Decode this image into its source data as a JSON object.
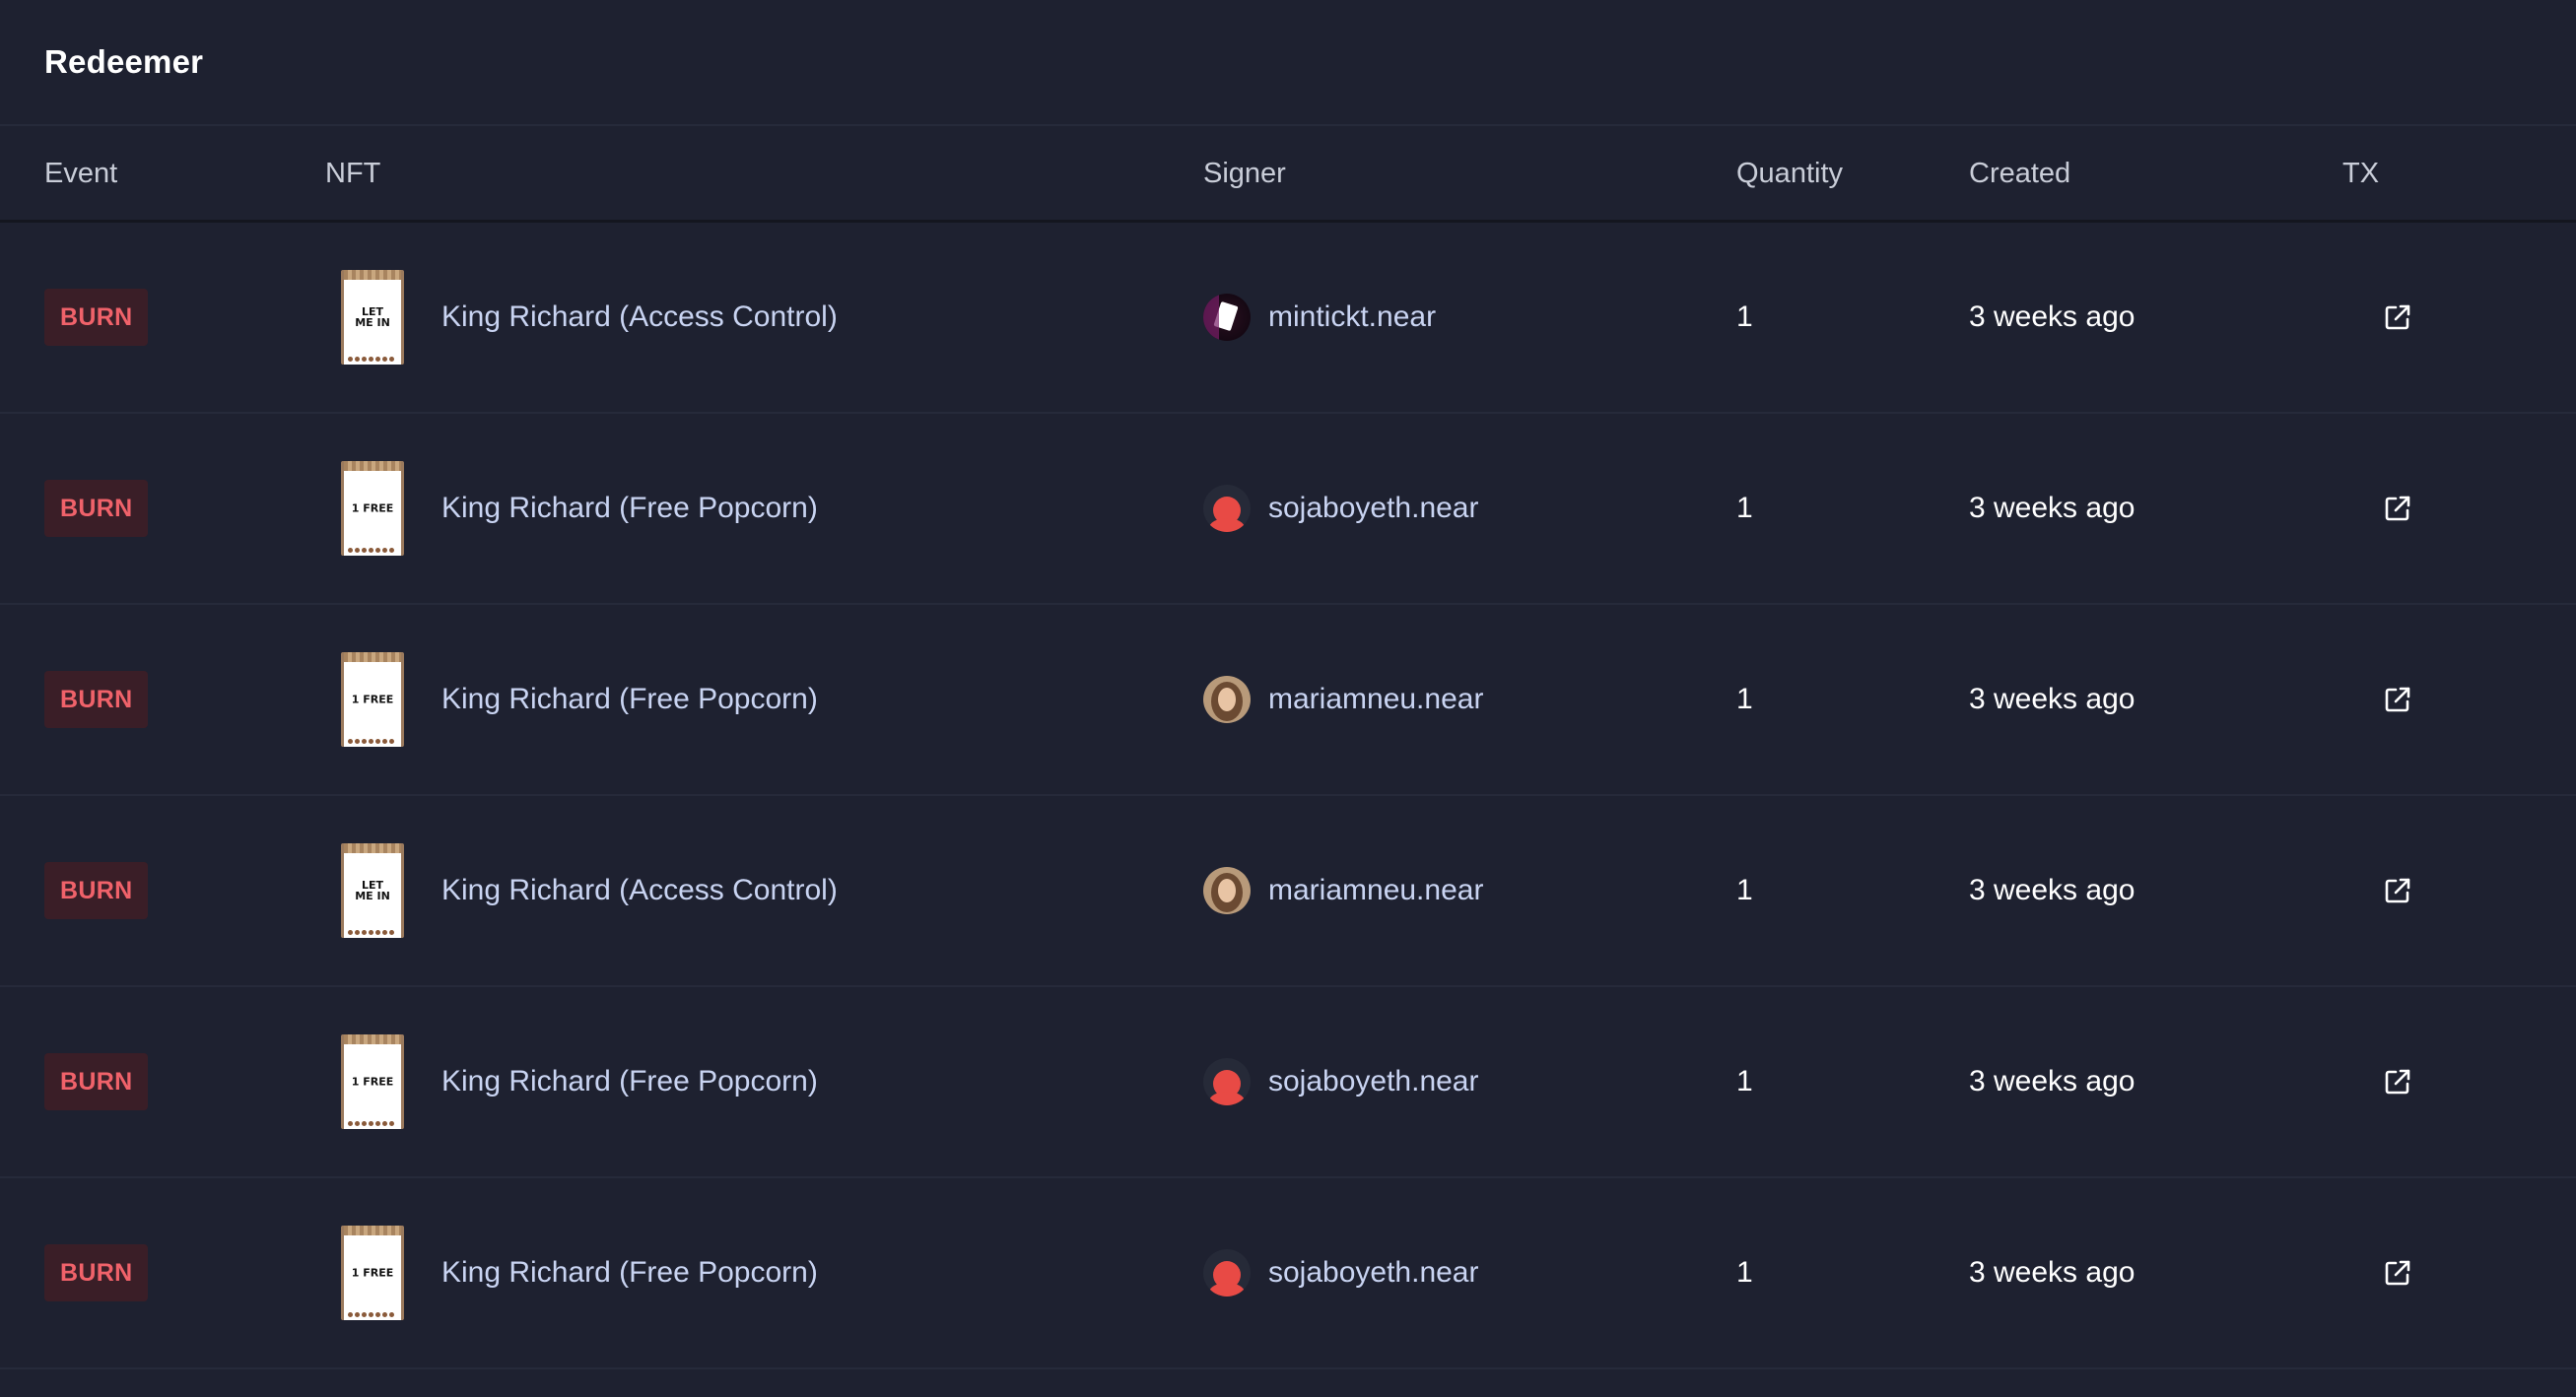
{
  "header": {
    "title": "Redeemer"
  },
  "columns": {
    "event": "Event",
    "nft": "NFT",
    "signer": "Signer",
    "quantity": "Quantity",
    "created": "Created",
    "tx": "TX"
  },
  "rows": [
    {
      "event": "BURN",
      "thumb": [
        "LET",
        "ME IN"
      ],
      "nft": "King Richard (Access Control)",
      "avatar": "mint",
      "signer": "mintickt.near",
      "quantity": "1",
      "created": "3 weeks ago"
    },
    {
      "event": "BURN",
      "thumb": [
        "1 FREE",
        ""
      ],
      "nft": "King Richard (Free Popcorn)",
      "avatar": "soja",
      "signer": "sojaboyeth.near",
      "quantity": "1",
      "created": "3 weeks ago"
    },
    {
      "event": "BURN",
      "thumb": [
        "1 FREE",
        ""
      ],
      "nft": "King Richard (Free Popcorn)",
      "avatar": "maria",
      "signer": "mariamneu.near",
      "quantity": "1",
      "created": "3 weeks ago"
    },
    {
      "event": "BURN",
      "thumb": [
        "LET",
        "ME IN"
      ],
      "nft": "King Richard (Access Control)",
      "avatar": "maria",
      "signer": "mariamneu.near",
      "quantity": "1",
      "created": "3 weeks ago"
    },
    {
      "event": "BURN",
      "thumb": [
        "1 FREE",
        ""
      ],
      "nft": "King Richard (Free Popcorn)",
      "avatar": "soja",
      "signer": "sojaboyeth.near",
      "quantity": "1",
      "created": "3 weeks ago"
    },
    {
      "event": "BURN",
      "thumb": [
        "1 FREE",
        ""
      ],
      "nft": "King Richard (Free Popcorn)",
      "avatar": "soja",
      "signer": "sojaboyeth.near",
      "quantity": "1",
      "created": "3 weeks ago"
    }
  ],
  "icons": {
    "tx": "external-link-icon"
  },
  "colors": {
    "background": "#1e2130",
    "badge_bg": "#3a1e27",
    "badge_text": "#f0626a",
    "link_text": "#c9d4f2"
  }
}
